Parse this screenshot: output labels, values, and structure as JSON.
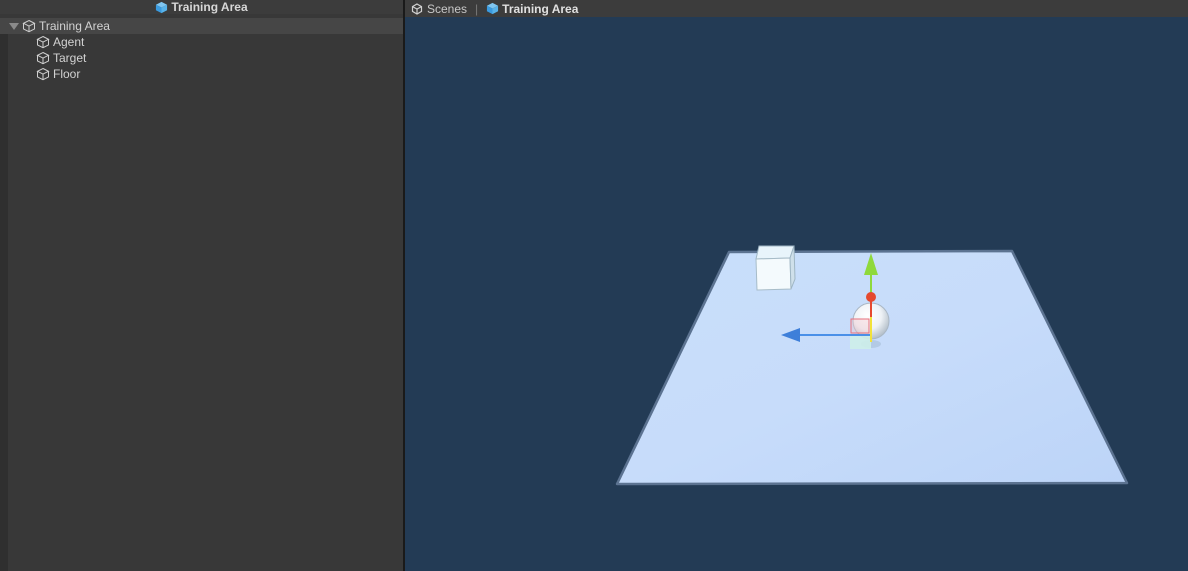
{
  "hierarchy": {
    "title": "Training Area",
    "root": {
      "label": "Training Area",
      "expanded": true
    },
    "children": [
      {
        "label": "Agent"
      },
      {
        "label": "Target"
      },
      {
        "label": "Floor"
      }
    ]
  },
  "scene": {
    "breadcrumb": {
      "scenes_label": "Scenes",
      "current_label": "Training Area"
    },
    "colors": {
      "background": "#233b55",
      "floor": "#c3dbfb",
      "x_axis": "#e5492f",
      "y_axis": "#8fd93b",
      "z_axis": "#4a90e8"
    }
  }
}
